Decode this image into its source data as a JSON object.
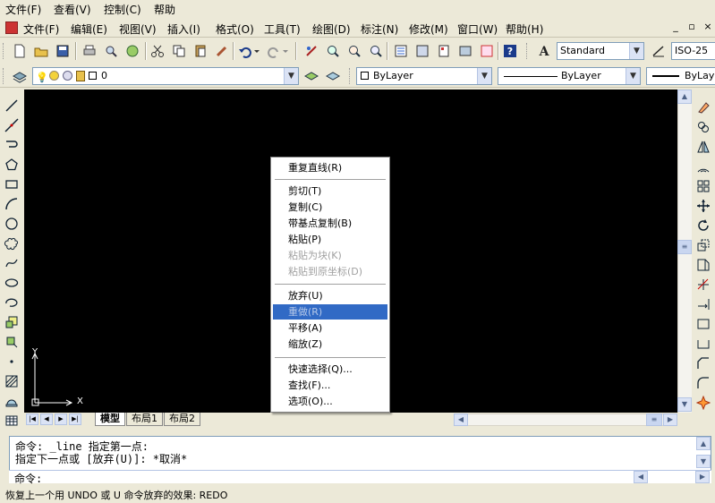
{
  "outer_menu": [
    "文件(F)",
    "查看(V)",
    "控制(C)",
    "帮助"
  ],
  "inner_menu": [
    "文件(F)",
    "编辑(E)",
    "视图(V)",
    "插入(I)",
    "格式(O)",
    "工具(T)",
    "绘图(D)",
    "标注(N)",
    "修改(M)",
    "窗口(W)",
    "帮助(H)"
  ],
  "window_buttons": [
    "_",
    "▫",
    "×"
  ],
  "toolbar": {
    "text_style": "Standard",
    "dim_style": "ISO-25",
    "layer_name": "0",
    "color": "ByLayer",
    "linetype": "ByLayer",
    "lineweight": "ByLayer"
  },
  "context_menu": {
    "groups": [
      [
        {
          "label": "重复直线(R)",
          "disabled": false,
          "selected": false
        }
      ],
      [
        {
          "label": "剪切(T)",
          "disabled": false,
          "selected": false
        },
        {
          "label": "复制(C)",
          "disabled": false,
          "selected": false
        },
        {
          "label": "带基点复制(B)",
          "disabled": false,
          "selected": false
        },
        {
          "label": "粘贴(P)",
          "disabled": false,
          "selected": false
        },
        {
          "label": "粘贴为块(K)",
          "disabled": true,
          "selected": false
        },
        {
          "label": "粘贴到原坐标(D)",
          "disabled": true,
          "selected": false
        }
      ],
      [
        {
          "label": "放弃(U)",
          "disabled": false,
          "selected": false
        },
        {
          "label": "重做(R)",
          "disabled": true,
          "selected": true
        },
        {
          "label": "平移(A)",
          "disabled": false,
          "selected": false
        },
        {
          "label": "缩放(Z)",
          "disabled": false,
          "selected": false
        }
      ],
      [
        {
          "label": "快速选择(Q)...",
          "disabled": false,
          "selected": false
        },
        {
          "label": "查找(F)...",
          "disabled": false,
          "selected": false
        },
        {
          "label": "选项(O)...",
          "disabled": false,
          "selected": false
        }
      ]
    ]
  },
  "ucs": {
    "x_label": "X",
    "y_label": "Y"
  },
  "tabs": [
    "模型",
    "布局1",
    "布局2"
  ],
  "command": {
    "lines": [
      "命令: _line 指定第一点:",
      "指定下一点或 [放弃(U)]: *取消*"
    ],
    "prompt": "命令:"
  },
  "status": "恢复上一个用 UNDO 或 U 命令放弃的效果:  REDO",
  "colors": {
    "canvas": "#000000",
    "selection": "#316ac5",
    "chrome": "#ece9d8"
  }
}
